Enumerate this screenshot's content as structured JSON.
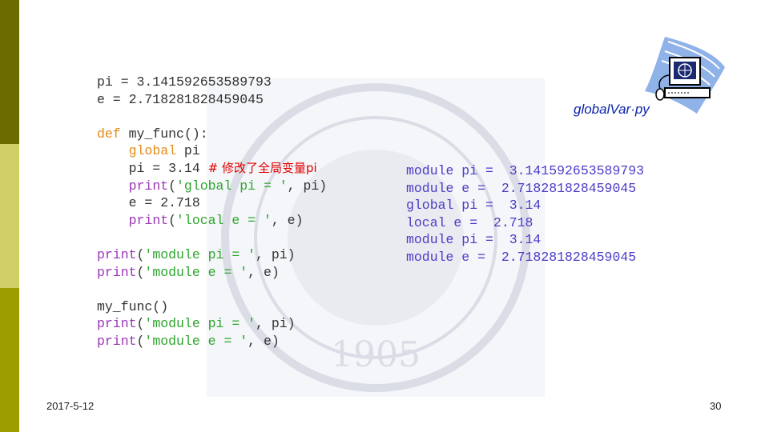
{
  "code": {
    "lines": [
      [
        {
          "t": "pi = 3.141592653589793",
          "c": "plain"
        }
      ],
      [
        {
          "t": "e = 2.718281828459045",
          "c": "plain"
        }
      ],
      [],
      [
        {
          "t": "def",
          "c": "kw"
        },
        {
          "t": " my_func():",
          "c": "plain"
        }
      ],
      [
        {
          "t": "    ",
          "c": "plain"
        },
        {
          "t": "global",
          "c": "kw"
        },
        {
          "t": " pi",
          "c": "plain"
        }
      ],
      [
        {
          "t": "    pi = 3.14 ",
          "c": "plain"
        },
        {
          "t": "# 修改了全局变量pi",
          "c": "cm"
        }
      ],
      [
        {
          "t": "    ",
          "c": "plain"
        },
        {
          "t": "print",
          "c": "pr"
        },
        {
          "t": "(",
          "c": "plain"
        },
        {
          "t": "'global pi = '",
          "c": "str"
        },
        {
          "t": ", pi)",
          "c": "plain"
        }
      ],
      [
        {
          "t": "    e = 2.718",
          "c": "plain"
        }
      ],
      [
        {
          "t": "    ",
          "c": "plain"
        },
        {
          "t": "print",
          "c": "pr"
        },
        {
          "t": "(",
          "c": "plain"
        },
        {
          "t": "'local e = '",
          "c": "str"
        },
        {
          "t": ", e)",
          "c": "plain"
        }
      ],
      [],
      [
        {
          "t": "print",
          "c": "pr"
        },
        {
          "t": "(",
          "c": "plain"
        },
        {
          "t": "'module pi = '",
          "c": "str"
        },
        {
          "t": ", pi)",
          "c": "plain"
        }
      ],
      [
        {
          "t": "print",
          "c": "pr"
        },
        {
          "t": "(",
          "c": "plain"
        },
        {
          "t": "'module e = '",
          "c": "str"
        },
        {
          "t": ", e)",
          "c": "plain"
        }
      ],
      [],
      [
        {
          "t": "my_func()",
          "c": "plain"
        }
      ],
      [
        {
          "t": "print",
          "c": "pr"
        },
        {
          "t": "(",
          "c": "plain"
        },
        {
          "t": "'module pi = '",
          "c": "str"
        },
        {
          "t": ", pi)",
          "c": "plain"
        }
      ],
      [
        {
          "t": "print",
          "c": "pr"
        },
        {
          "t": "(",
          "c": "plain"
        },
        {
          "t": "'module e = '",
          "c": "str"
        },
        {
          "t": ", e)",
          "c": "plain"
        }
      ]
    ]
  },
  "output": {
    "lines": [
      "module pi =  3.141592653589793",
      "module e =  2.718281828459045",
      "global pi =  3.14",
      "local e =  2.718",
      "module pi =  3.14",
      "module e =  2.718281828459045"
    ]
  },
  "file_label": "globalVar·py",
  "footer": {
    "date": "2017-5-12",
    "page": "30"
  },
  "watermark_text": "1905",
  "colors": {
    "band_dark": "#6b6b00",
    "band_light": "#cfcf66",
    "band_mid": "#9d9d00",
    "output_text": "#4a3cc8",
    "file_label": "#0b24a8",
    "comment": "#e00000"
  }
}
